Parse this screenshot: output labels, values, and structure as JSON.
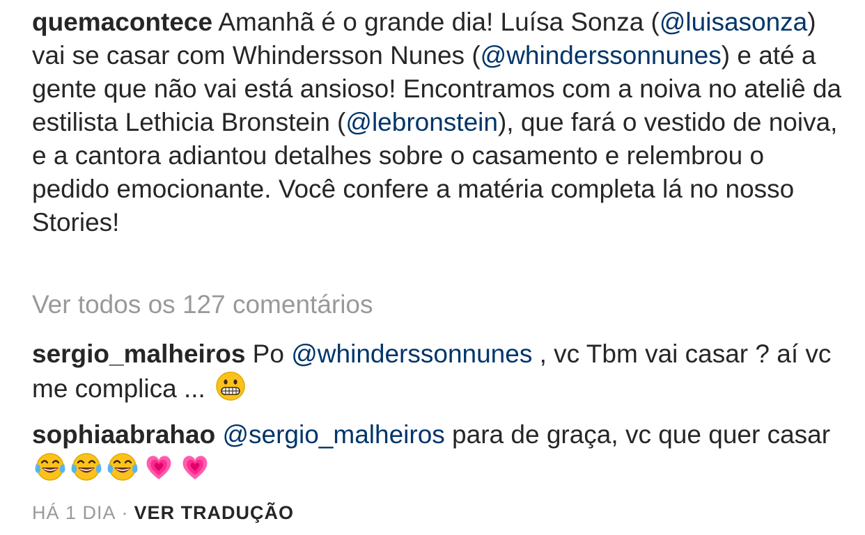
{
  "post": {
    "caption": {
      "username": "quemacontece",
      "text_1": " Amanhã é o grande dia! Luísa Sonza (",
      "mention_1": "@luisasonza",
      "text_2": ") vai se casar com Whindersson Nunes (",
      "mention_2": "@whinderssonnunes",
      "text_3": ") e até a gente que não vai está ansioso! Encontramos com a noiva no ateliê da estilista Lethicia Bronstein (",
      "mention_3": "@lebronstein",
      "text_4": "), que fará o vestido de noiva, e a cantora adiantou detalhes sobre o casamento e relembrou o pedido emocionante. Você confere a matéria completa lá no nosso Stories!"
    },
    "view_all_comments": "Ver todos os 127 comentários",
    "comments": [
      {
        "username": "sergio_malheiros",
        "text_1": " Po ",
        "mention": "@whinderssonnunes",
        "text_2": " , vc Tbm vai casar ? aí vc me complica ... ",
        "emojis": [
          "grimacing-face-emoji"
        ]
      },
      {
        "username": "sophiaabrahao",
        "mention": "@sergio_malheiros",
        "text_1": " para de graça, vc que quer casar ",
        "emojis": [
          "tears-of-joy-emoji",
          "tears-of-joy-emoji",
          "tears-of-joy-emoji",
          "growing-heart-emoji",
          "growing-heart-emoji"
        ]
      }
    ],
    "footer": {
      "time": "HÁ 1 DIA",
      "separator": "·",
      "translate": "VER TRADUÇÃO"
    },
    "colors": {
      "text": "#262626",
      "mention": "#003569",
      "muted": "#999999",
      "emoji_yellow": "#fcc21b",
      "heart_pink": "#ff2a8a"
    }
  }
}
